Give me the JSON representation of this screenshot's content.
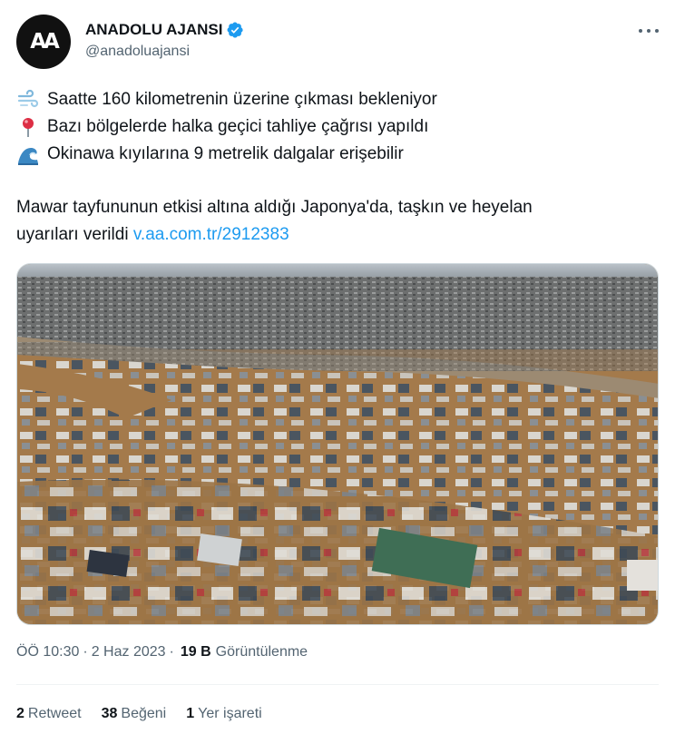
{
  "account": {
    "display_name": "ANADOLU AJANSI",
    "handle": "@anadoluajansi",
    "avatar_text": "AA"
  },
  "tweet": {
    "lines": [
      {
        "icon": "wind-face-icon",
        "text": "Saatte 160 kilometrenin üzerine çıkması bekleniyor"
      },
      {
        "icon": "round-pushpin-icon",
        "text": "Bazı bölgelerde halka geçici tahliye çağrısı yapıldı"
      },
      {
        "icon": "water-wave-icon",
        "text": "Okinawa kıyılarına 9 metrelik dalgalar erişebilir"
      }
    ],
    "paragraph_line1": "Mawar tayfununun etkisi altına aldığı Japonya'da, taşkın ve heyelan",
    "paragraph_line2": "uyarıları verildi",
    "link": "v.aa.com.tr/2912383"
  },
  "meta": {
    "time": "ÖÖ 10:30",
    "separator": "·",
    "date": "2 Haz 2023",
    "views_count": "19 B",
    "views_label": "Görüntülenme"
  },
  "stats": {
    "retweets_count": "2",
    "retweets_label": "Retweet",
    "likes_count": "38",
    "likes_label": "Beğeni",
    "bookmarks_count": "1",
    "bookmarks_label": "Yer işareti"
  },
  "colors": {
    "accent": "#1d9bf0",
    "secondary_text": "#536471",
    "flood_water": "#a47a4b"
  }
}
